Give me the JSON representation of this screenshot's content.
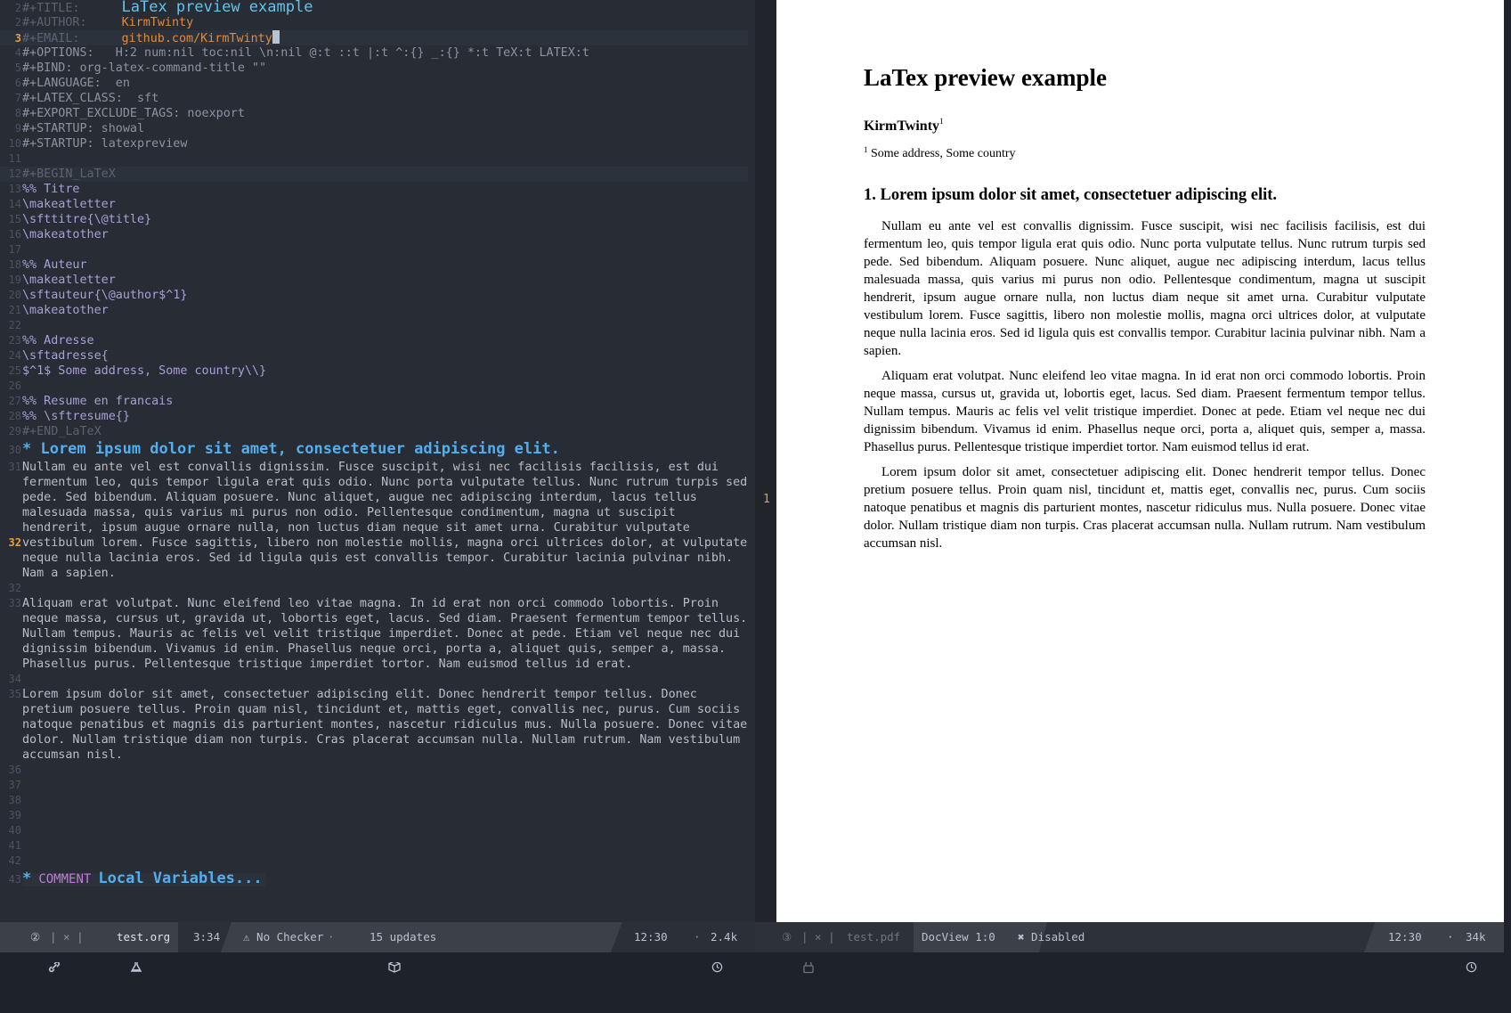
{
  "editor": {
    "header": [
      {
        "num": "2",
        "key": "#+TITLE:",
        "value": "LaTex preview example"
      },
      {
        "num": "2",
        "key": "#+AUTHOR:",
        "value": "KirmTwinty"
      },
      {
        "num": "3",
        "key": "#+EMAIL:",
        "value": "github.com/KirmTwinty"
      }
    ],
    "options": [
      {
        "num": "4",
        "text": "#+OPTIONS:   H:2 num:nil toc:nil \\n:nil @:t ::t |:t ^:{} _:{} *:t TeX:t LATEX:t"
      },
      {
        "num": "5",
        "text": "#+BIND: org-latex-command-title \"\""
      },
      {
        "num": "6",
        "text": "#+LANGUAGE:  en"
      },
      {
        "num": "7",
        "text": "#+LATEX_CLASS:  sft"
      },
      {
        "num": "8",
        "text": "#+EXPORT_EXCLUDE_TAGS: noexport"
      },
      {
        "num": "9",
        "text": "#+STARTUP: showal"
      },
      {
        "num": "10",
        "text": "#+STARTUP: latexpreview"
      },
      {
        "num": "11",
        "text": ""
      }
    ],
    "latex_block": [
      {
        "num": "12",
        "text": "#+BEGIN_LaTeX",
        "kind": "dim"
      },
      {
        "num": "13",
        "text": "%% Titre",
        "kind": "latex"
      },
      {
        "num": "14",
        "text": "\\makeatletter",
        "kind": "latex"
      },
      {
        "num": "15",
        "text": "\\sfttitre{\\@title}",
        "kind": "latex"
      },
      {
        "num": "16",
        "text": "\\makeatother",
        "kind": "latex"
      },
      {
        "num": "17",
        "text": "",
        "kind": "latex"
      },
      {
        "num": "18",
        "text": "%% Auteur",
        "kind": "latex"
      },
      {
        "num": "19",
        "text": "\\makeatletter",
        "kind": "latex"
      },
      {
        "num": "20",
        "text": "\\sftauteur{\\@author$^1}",
        "kind": "latex"
      },
      {
        "num": "21",
        "text": "\\makeatother",
        "kind": "latex"
      },
      {
        "num": "22",
        "text": "",
        "kind": "latex"
      },
      {
        "num": "23",
        "text": "%% Adresse",
        "kind": "latex"
      },
      {
        "num": "24",
        "text": "\\sftadresse{",
        "kind": "latex"
      },
      {
        "num": "25",
        "text": "$^1$ Some address, Some country\\\\}",
        "kind": "latex"
      },
      {
        "num": "26",
        "text": "",
        "kind": "latex"
      },
      {
        "num": "27",
        "text": "%% Resume en francais",
        "kind": "latex"
      },
      {
        "num": "28",
        "text": "%% \\sftresume{}",
        "kind": "latex"
      },
      {
        "num": "29",
        "text": "#+END_LaTeX",
        "kind": "dim"
      }
    ],
    "heading": {
      "num": "30",
      "text": "* Lorem ipsum dolor sit amet, consectetuer adipiscing elit."
    },
    "body": [
      {
        "num": "31",
        "text": "Nullam eu ante vel est convallis dignissim. Fusce suscipit, wisi nec facilisis facilisis, est dui"
      },
      {
        "num": "",
        "text": "fermentum leo, quis tempor ligula erat quis odio. Nunc porta vulputate tellus. Nunc rutrum turpis sed"
      },
      {
        "num": "",
        "text": "pede. Sed bibendum. Aliquam posuere. Nunc aliquet, augue nec adipiscing interdum, lacus tellus"
      },
      {
        "num": "",
        "text": "malesuada massa, quis varius mi purus non odio. Pellentesque condimentum, magna ut suscipit"
      },
      {
        "num": "",
        "text": "hendrerit, ipsum augue ornare nulla, non luctus diam neque sit amet urna. Curabitur vulputate"
      },
      {
        "num": "32",
        "text": "vestibulum lorem. Fusce sagittis, libero non molestie mollis, magna orci ultrices dolor, at vulputate",
        "cur": true
      },
      {
        "num": "",
        "text": "neque nulla lacinia eros. Sed id ligula quis est convallis tempor. Curabitur lacinia pulvinar nibh."
      },
      {
        "num": "",
        "text": "Nam a sapien."
      },
      {
        "num": "32",
        "text": ""
      },
      {
        "num": "33",
        "text": "Aliquam erat volutpat. Nunc eleifend leo vitae magna. In id erat non orci commodo lobortis. Proin"
      },
      {
        "num": "",
        "text": "neque massa, cursus ut, gravida ut, lobortis eget, lacus. Sed diam. Praesent fermentum tempor tellus."
      },
      {
        "num": "",
        "text": "Nullam tempus. Mauris ac felis vel velit tristique imperdiet. Donec at pede. Etiam vel neque nec dui"
      },
      {
        "num": "",
        "text": "dignissim bibendum. Vivamus id enim. Phasellus neque orci, porta a, aliquet quis, semper a, massa."
      },
      {
        "num": "",
        "text": "Phasellus purus. Pellentesque tristique imperdiet tortor. Nam euismod tellus id erat."
      },
      {
        "num": "34",
        "text": ""
      },
      {
        "num": "35",
        "text": "Lorem ipsum dolor sit amet, consectetuer adipiscing elit. Donec hendrerit tempor tellus. Donec"
      },
      {
        "num": "",
        "text": "pretium posuere tellus. Proin quam nisl, tincidunt et, mattis eget, convallis nec, purus. Cum sociis"
      },
      {
        "num": "",
        "text": "natoque penatibus et magnis dis parturient montes, nascetur ridiculus mus. Nulla posuere. Donec vitae"
      },
      {
        "num": "",
        "text": "dolor. Nullam tristique diam non turpis. Cras placerat accumsan nulla. Nullam rutrum. Nam vestibulum"
      },
      {
        "num": "",
        "text": "accumsan nisl."
      },
      {
        "num": "36",
        "text": ""
      },
      {
        "num": "37",
        "text": ""
      },
      {
        "num": "38",
        "text": ""
      },
      {
        "num": "39",
        "text": ""
      },
      {
        "num": "40",
        "text": ""
      },
      {
        "num": "41",
        "text": ""
      },
      {
        "num": "42",
        "text": ""
      }
    ],
    "local_vars": {
      "num": "43",
      "star": "*",
      "keyword": "COMMENT",
      "text": "Local Variables..."
    }
  },
  "fringe_marker": "1",
  "pdf": {
    "title": "LaTex preview example",
    "author": "KirmTwinty",
    "author_sup": "1",
    "address_sup": "1",
    "address": "Some address, Some country",
    "section": "1.  Lorem ipsum dolor sit amet, consectetuer adipiscing elit.",
    "paragraphs": [
      "Nullam eu ante vel est convallis dignissim. Fusce suscipit, wisi nec facilisis facilisis, est dui fermentum leo, quis tempor ligula erat quis odio. Nunc porta vulputate tellus. Nunc rutrum turpis sed pede. Sed bibendum. Aliquam posuere. Nunc aliquet, augue nec adipiscing interdum, lacus tellus malesuada massa, quis varius mi purus non odio. Pellentesque condimentum, magna ut suscipit hendrerit, ipsum augue ornare nulla, non luctus diam neque sit amet urna. Curabitur vulputate vestibulum lorem. Fusce sagittis, libero non molestie mollis, magna orci ultrices dolor, at vulputate neque nulla lacinia eros. Sed id ligula quis est convallis tempor. Curabitur lacinia pulvinar nibh. Nam a sapien.",
      "Aliquam erat volutpat. Nunc eleifend leo vitae magna. In id erat non orci commodo lobortis. Proin neque massa, cursus ut, gravida ut, lobortis eget, lacus. Sed diam. Praesent fermentum tempor tellus. Nullam tempus. Mauris ac felis vel velit tristique imperdiet. Donec at pede. Etiam vel neque nec dui dignissim bibendum. Vivamus id enim. Phasellus neque orci, porta a, aliquet quis, semper a, massa. Phasellus purus. Pellentesque tristique imperdiet tortor. Nam euismod tellus id erat.",
      "Lorem ipsum dolor sit amet, consectetuer adipiscing elit. Donec hendrerit tempor tellus. Donec pretium posuere tellus. Proin quam nisl, tincidunt et, mattis eget, convallis nec, purus. Cum sociis natoque penatibus et magnis dis parturient montes, nascetur ridiculus mus. Nulla posuere. Donec vitae dolor. Nullam tristique diam non turpis. Cras placerat accumsan nulla. Nullam rutrum. Nam vestibulum accumsan nisl."
    ]
  },
  "modeline_left": {
    "workspace": "②",
    "sep": "| × |",
    "buffer": "test.org",
    "position": "3:34",
    "checker": "⚠ No Checker",
    "updates": "15 updates",
    "time": "12:30",
    "size": "2.4k"
  },
  "modeline_right": {
    "workspace": "③",
    "sep": "| × |",
    "buffer": "test.pdf",
    "mode": "DocView 1:0",
    "status": "✖ Disabled",
    "time": "12:30",
    "size": "34k"
  },
  "colors": {
    "editor_bg": "#282c34",
    "heading": "#51afef",
    "author": "#e08a3e",
    "latex": "#a8a0d8",
    "line_current": "#e5a041"
  }
}
